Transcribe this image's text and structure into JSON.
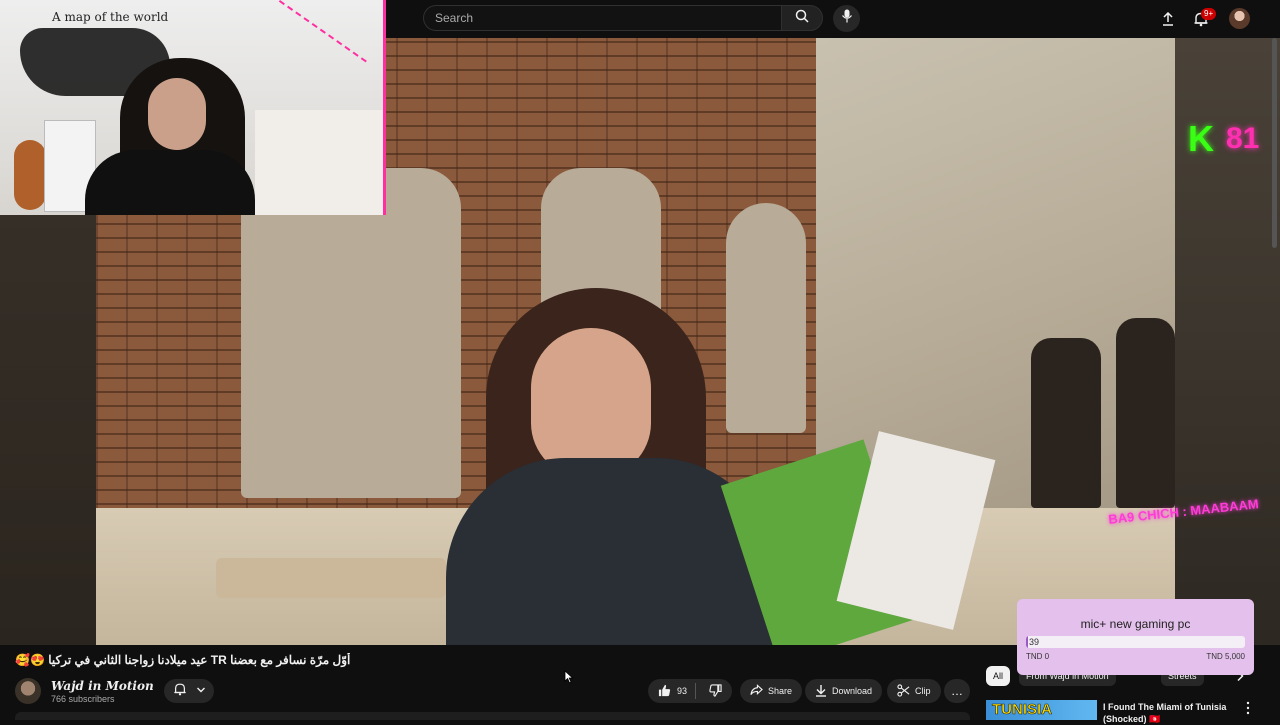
{
  "search": {
    "placeholder": "Search"
  },
  "header": {
    "notification_count": "9+"
  },
  "overlay": {
    "neon_k": "K",
    "neon_num": "81",
    "neon_bottom": "BA9 CHICH : MAABAAM",
    "webcam_map_text": "A map of the world"
  },
  "donation": {
    "title": "mic+ new gaming pc",
    "current": "39",
    "progress": 0.0078,
    "min_label": "TND 0",
    "max_label": "TND 5,000"
  },
  "video": {
    "title": "أوّل مرّة نسافر مع بعضنا TR عيد ميلادنا زواجنا الثاني في تركيا 😍🥰"
  },
  "channel": {
    "name": "Wajd in Motion",
    "subscribers": "766 subscribers"
  },
  "actions": {
    "like_count": "93",
    "share": "Share",
    "download": "Download",
    "clip": "Clip",
    "more": "…"
  },
  "chips": [
    "All",
    "From Wajd in Motion",
    "Streets"
  ],
  "recommended": {
    "thumb_text": "TUNISIA",
    "title": "I Found The Miami of Tunisia (Shocked) 🇹🇳"
  },
  "colors": {
    "background": "#0f0f0f",
    "accent_red": "#cc0000",
    "donation_bg": "#e4c1ec",
    "neon_green": "#39ff14",
    "neon_pink": "#ff2fb1"
  },
  "icons": [
    "search-icon",
    "mic-icon",
    "upload-icon",
    "bell-icon",
    "chevron-down-icon",
    "thumbs-up-icon",
    "thumbs-down-icon",
    "share-icon",
    "download-icon",
    "scissors-icon",
    "more-icon",
    "chevron-right-icon",
    "kebab-icon"
  ]
}
